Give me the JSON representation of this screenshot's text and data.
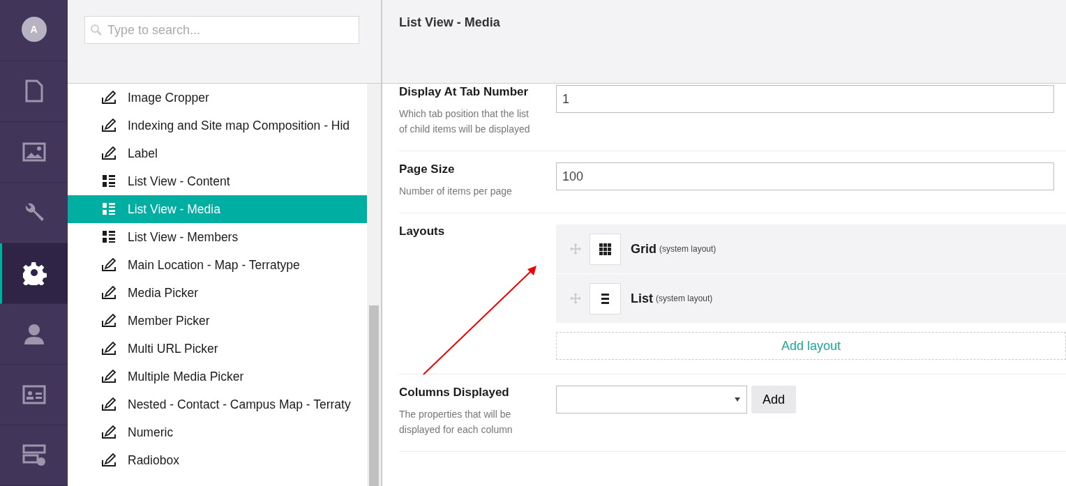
{
  "nav": {
    "avatar": "A",
    "items": [
      {
        "kind": "document",
        "selected": false
      },
      {
        "kind": "image",
        "selected": false
      },
      {
        "kind": "wrench",
        "selected": false
      },
      {
        "kind": "gear",
        "selected": true
      },
      {
        "kind": "person",
        "selected": false
      },
      {
        "kind": "card",
        "selected": false
      },
      {
        "kind": "template",
        "selected": false
      }
    ]
  },
  "search": {
    "placeholder": "Type to search..."
  },
  "tree": [
    {
      "label": "Image Cropper",
      "kind": "edit",
      "selected": false
    },
    {
      "label": "Indexing and Site map Composition - Hid",
      "kind": "edit",
      "selected": false
    },
    {
      "label": "Label",
      "kind": "edit",
      "selected": false
    },
    {
      "label": "List View - Content",
      "kind": "listview",
      "selected": false
    },
    {
      "label": "List View - Media",
      "kind": "listview",
      "selected": true
    },
    {
      "label": "List View - Members",
      "kind": "listview",
      "selected": false
    },
    {
      "label": "Main Location - Map - Terratype",
      "kind": "edit",
      "selected": false
    },
    {
      "label": "Media Picker",
      "kind": "edit",
      "selected": false
    },
    {
      "label": "Member Picker",
      "kind": "edit",
      "selected": false
    },
    {
      "label": "Multi URL Picker",
      "kind": "edit",
      "selected": false
    },
    {
      "label": "Multiple Media Picker",
      "kind": "edit",
      "selected": false
    },
    {
      "label": "Nested - Contact - Campus Map - Terraty",
      "kind": "edit",
      "selected": false
    },
    {
      "label": "Numeric",
      "kind": "edit",
      "selected": false
    },
    {
      "label": "Radiobox",
      "kind": "edit",
      "selected": false
    }
  ],
  "editor": {
    "title": "List View - Media",
    "properties": [
      {
        "kind": "text",
        "label": "Display At Tab Number",
        "description": "Which tab position that the list of child items will be displayed",
        "value": "1"
      },
      {
        "kind": "text",
        "label": "Page Size",
        "description": "Number of items per page",
        "value": "100"
      },
      {
        "kind": "layouts",
        "label": "Layouts",
        "layouts": [
          {
            "kind": "grid",
            "name": "Grid",
            "note": "(system layout)"
          },
          {
            "kind": "list",
            "name": "List",
            "note": "(system layout)"
          }
        ],
        "add": "Add layout"
      },
      {
        "kind": "columns",
        "label": "Columns Displayed",
        "description": "The properties that will be displayed for each column",
        "button": "Add"
      }
    ]
  }
}
